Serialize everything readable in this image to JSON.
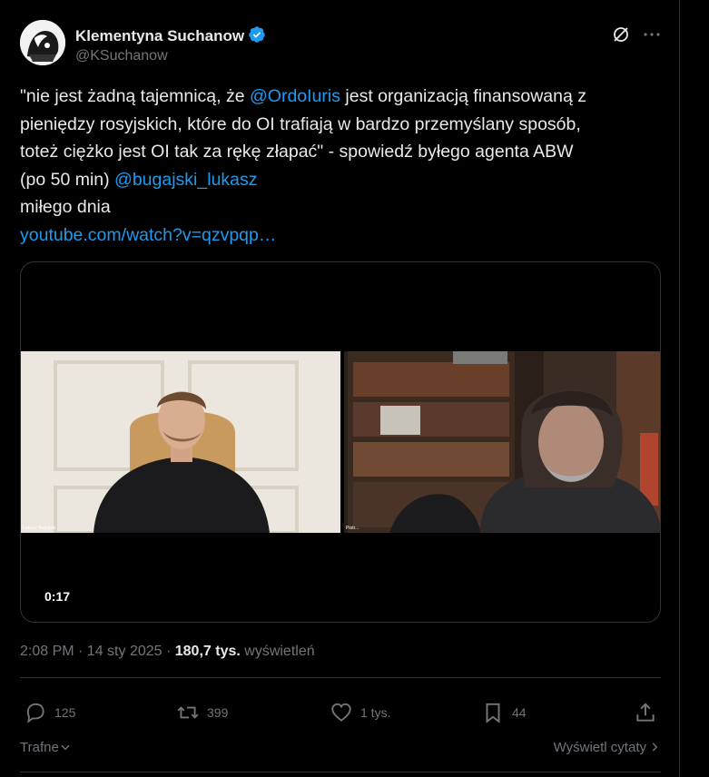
{
  "author": {
    "name": "Klementyna Suchanow",
    "handle": "@KSuchanow"
  },
  "icons": {
    "verified": "verified-badge-icon",
    "grok": "grok-icon",
    "more": "more-icon",
    "reply": "reply-icon",
    "retweet": "retweet-icon",
    "like": "like-icon",
    "bookmark": "bookmark-icon",
    "share": "share-icon"
  },
  "colors": {
    "accent": "#1d9bf0",
    "text": "#e7e9ea",
    "muted": "#71767b",
    "background": "#000000"
  },
  "tweet": {
    "line1_pre": "\"nie jest żadną tajemnicą, że ",
    "line1_mention": "@OrdoIuris",
    "line1_post": " jest organizacją finansowaną z",
    "line2": "pieniędzy rosyjskich, które do OI trafiają w bardzo przemyślany sposób,",
    "line3": "toteż ciężko jest OI tak za rękę złapać\" - spowiedź byłego agenta ABW",
    "line4_pre": "(po 50 min) ",
    "line4_mention": "@bugajski_lukasz",
    "line5": "miłego dnia",
    "link": "youtube.com/watch?v=qzvpqp…"
  },
  "video": {
    "timestamp": "0:17",
    "left_label": "Łukasz Bugajski",
    "right_label": "Piotr..."
  },
  "meta": {
    "time": "2:08 PM · 14 sty 2025 · ",
    "views": "180,7 tys.",
    "views_label": " wyświetleń"
  },
  "actions": {
    "replies": "125",
    "retweets": "399",
    "likes": "1 tys.",
    "bookmarks": "44"
  },
  "footer": {
    "sort_label": "Trafne",
    "quotes_label": "Wyświetl cytaty"
  }
}
